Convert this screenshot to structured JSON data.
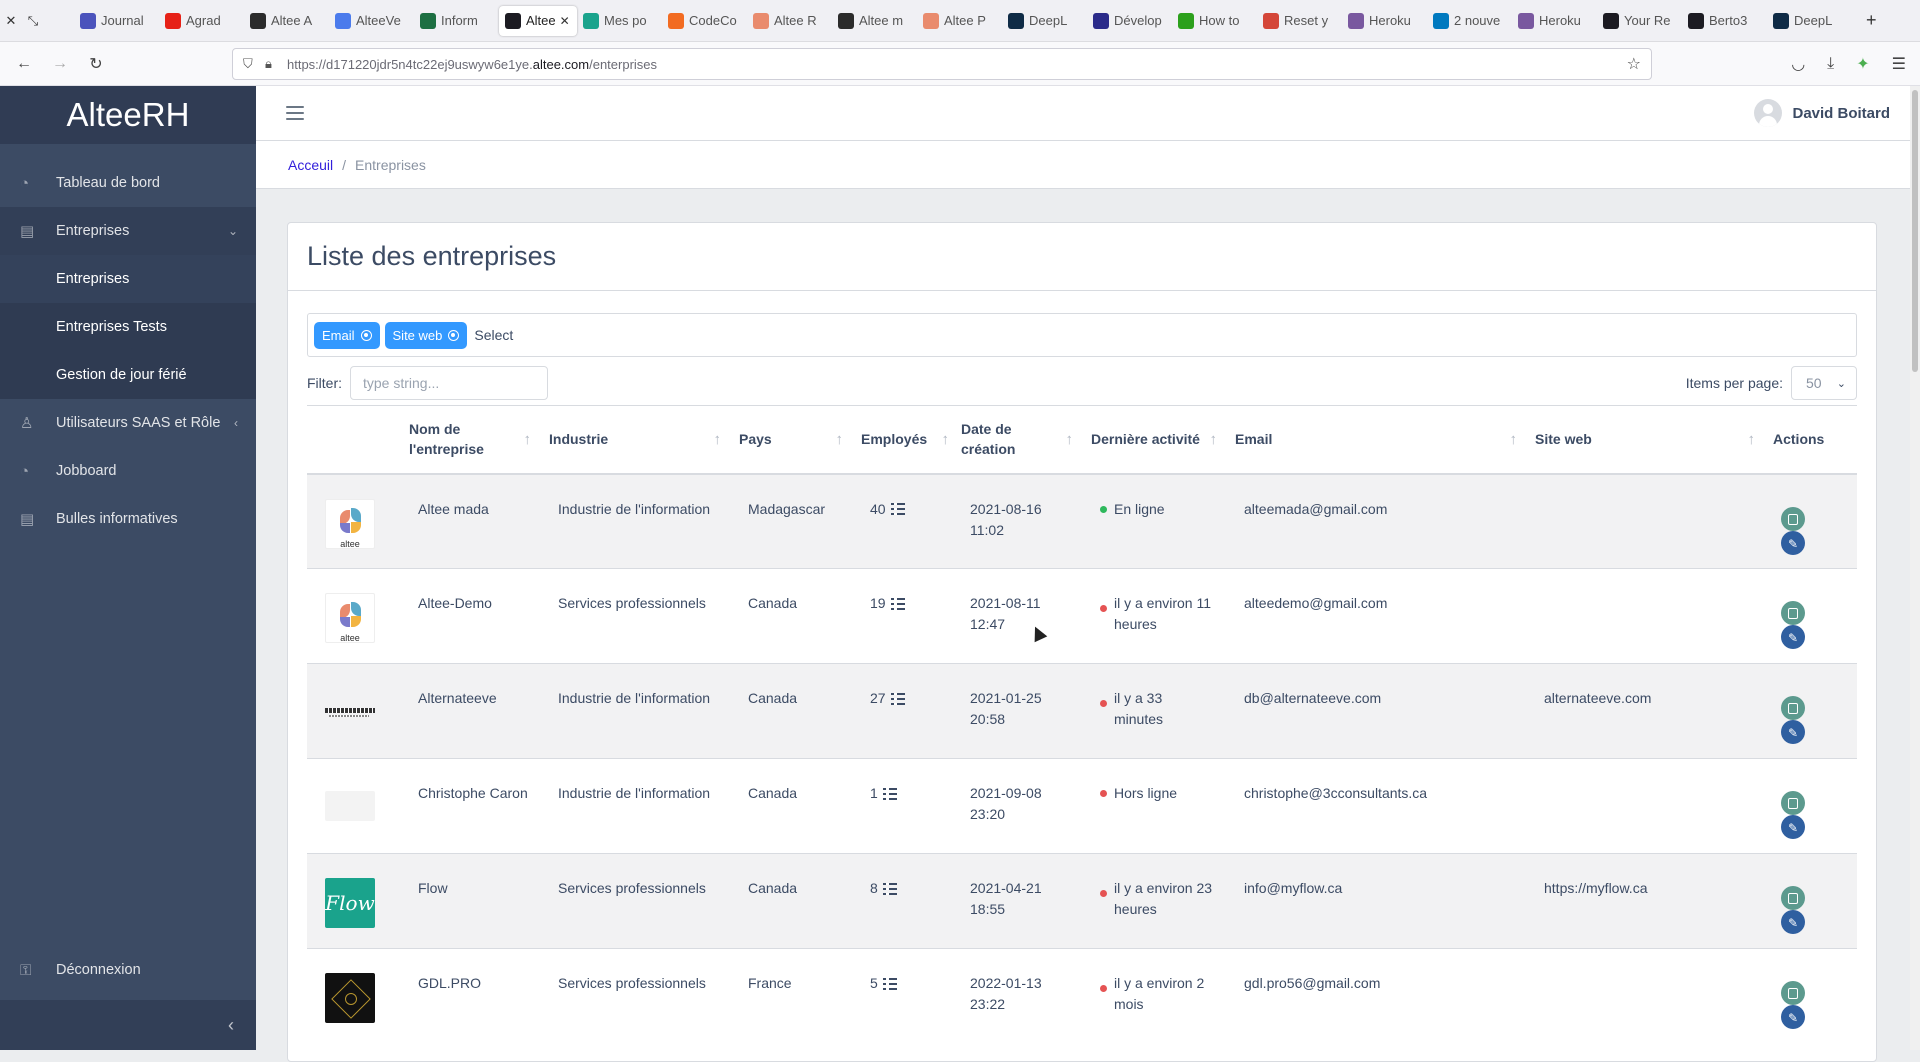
{
  "browser": {
    "tabs": [
      {
        "label": "Journal",
        "color": "#4b53bc"
      },
      {
        "label": "Agrad",
        "color": "#e62117"
      },
      {
        "label": "Altee A",
        "color": "#2b2b2b"
      },
      {
        "label": "AlteeVe",
        "color": "#4b7bec"
      },
      {
        "label": "Inform",
        "color": "#1d6f42"
      },
      {
        "label": "Altee",
        "color": "#1c1b22",
        "active": true
      },
      {
        "label": "Mes po",
        "color": "#1aa38c"
      },
      {
        "label": "CodeCo",
        "color": "#f26b21"
      },
      {
        "label": "Altee R",
        "color": "#e98b6d"
      },
      {
        "label": "Altee m",
        "color": "#2b2b2b"
      },
      {
        "label": "Altee P",
        "color": "#e98b6d"
      },
      {
        "label": "DeepL",
        "color": "#0f2b46"
      },
      {
        "label": "Dévelop",
        "color": "#2b2b8a"
      },
      {
        "label": "How to",
        "color": "#2ca01c"
      },
      {
        "label": "Reset y",
        "color": "#d44638"
      },
      {
        "label": "Heroku",
        "color": "#79589f"
      },
      {
        "label": "2 nouve",
        "color": "#0079bf"
      },
      {
        "label": "Heroku",
        "color": "#79589f"
      },
      {
        "label": "Your Re",
        "color": "#1c1b22"
      },
      {
        "label": "Berto3",
        "color": "#1c1b22"
      },
      {
        "label": "DeepL",
        "color": "#0f2b46"
      }
    ],
    "url_prefix": "https://d171220jdr5n4tc22ej9uswyw6e1ye.",
    "url_domain": "altee.com",
    "url_path": "/enterprises"
  },
  "sidebar": {
    "brand": "AlteeRH",
    "dashboard": "Tableau de bord",
    "enterprises": "Entreprises",
    "sub_enterprises": "Entreprises",
    "sub_tests": "Entreprises Tests",
    "sub_holidays": "Gestion de jour férié",
    "users": "Utilisateurs SAAS et Rôle",
    "jobboard": "Jobboard",
    "bubbles": "Bulles informatives",
    "logout": "Déconnexion"
  },
  "header": {
    "user_name": "David Boitard"
  },
  "breadcrumb": {
    "home": "Acceuil",
    "current": "Entreprises"
  },
  "card": {
    "title": "Liste des entreprises",
    "chips": [
      "Email",
      "Site web"
    ],
    "select_placeholder": "Select",
    "filter_label": "Filter:",
    "filter_placeholder": "type string...",
    "items_per_page_label": "Items per page:",
    "items_per_page_value": "50"
  },
  "table": {
    "columns": {
      "name": "Nom de l'entreprise",
      "industry": "Industrie",
      "country": "Pays",
      "employees": "Employés",
      "created": "Date de création",
      "activity": "Dernière activité",
      "email": "Email",
      "website": "Site web",
      "actions": "Actions"
    },
    "rows": [
      {
        "name": "Altee mada",
        "industry": "Industrie de l'information",
        "country": "Madagascar",
        "employees": "40",
        "created": "2021-08-16 11:02",
        "activity": "En ligne",
        "email": "alteemada@gmail.com",
        "website": ""
      },
      {
        "name": "Altee-Demo",
        "industry": "Services professionnels",
        "country": "Canada",
        "employees": "19",
        "created": "2021-08-11 12:47",
        "activity": "il y a environ 11 heures",
        "email": "alteedemo@gmail.com",
        "website": ""
      },
      {
        "name": "Alternateeve",
        "industry": "Industrie de l'information",
        "country": "Canada",
        "employees": "27",
        "created": "2021-01-25 20:58",
        "activity": "il y a 33 minutes",
        "email": "db@alternateeve.com",
        "website": "alternateeve.com"
      },
      {
        "name": "Christophe Caron",
        "industry": "Industrie de l'information",
        "country": "Canada",
        "employees": "1",
        "created": "2021-09-08 23:20",
        "activity": "Hors ligne",
        "email": "christophe@3cconsultants.ca",
        "website": ""
      },
      {
        "name": "Flow",
        "industry": "Services professionnels",
        "country": "Canada",
        "employees": "8",
        "created": "2021-04-21 18:55",
        "activity": "il y a environ 23 heures",
        "email": "info@myflow.ca",
        "website": "https://myflow.ca"
      },
      {
        "name": "GDL.PRO",
        "industry": "Services professionnels",
        "country": "France",
        "employees": "5",
        "created": "2022-01-13 23:22",
        "activity": "il y a environ 2 mois",
        "email": "gdl.pro56@gmail.com",
        "website": ""
      }
    ],
    "logo_texts": {
      "altee": "altee",
      "flow": "Flow"
    }
  }
}
